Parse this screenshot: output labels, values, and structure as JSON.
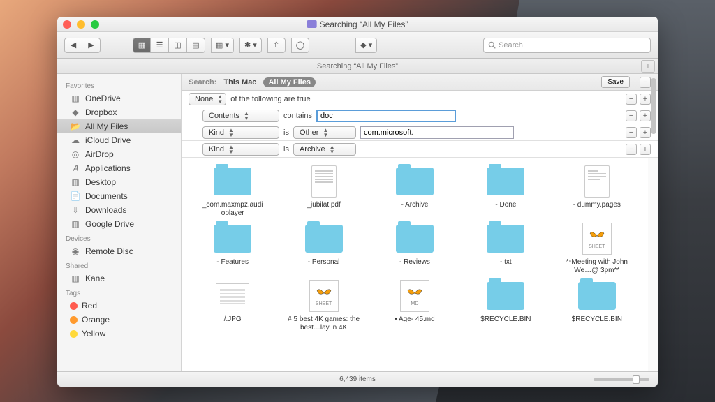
{
  "window": {
    "title": "Searching “All My Files”"
  },
  "toolbar": {
    "search_placeholder": "Search"
  },
  "pathbar": {
    "text": "Searching “All My Files”"
  },
  "sidebar": {
    "favorites": {
      "header": "Favorites",
      "items": [
        "OneDrive",
        "Dropbox",
        "All My Files",
        "iCloud Drive",
        "AirDrop",
        "Applications",
        "Desktop",
        "Documents",
        "Downloads",
        "Google Drive"
      ]
    },
    "devices": {
      "header": "Devices",
      "items": [
        "Remote Disc"
      ]
    },
    "shared": {
      "header": "Shared",
      "items": [
        "Kane"
      ]
    },
    "tags": {
      "header": "Tags",
      "items": [
        {
          "label": "Red",
          "color": "#ff5b4f"
        },
        {
          "label": "Orange",
          "color": "#ff9a2e"
        },
        {
          "label": "Yellow",
          "color": "#ffd93a"
        }
      ]
    }
  },
  "search": {
    "label": "Search:",
    "scope1": "This Mac",
    "scope2": "All My Files",
    "save": "Save",
    "rule0": {
      "match": "None",
      "suffix": "of the following are true"
    },
    "rule1": {
      "attr": "Contents",
      "op": "contains",
      "val": "doc"
    },
    "rule2": {
      "attr": "Kind",
      "op": "is",
      "val": "Other",
      "extra": "com.microsoft."
    },
    "rule3": {
      "attr": "Kind",
      "op": "is",
      "val": "Archive"
    }
  },
  "files": [
    {
      "type": "folder",
      "name": "_com.maxmpz.audi oplayer"
    },
    {
      "type": "pdf",
      "name": "_jubilat.pdf"
    },
    {
      "type": "folder",
      "name": "- Archive"
    },
    {
      "type": "folder",
      "name": "- Done"
    },
    {
      "type": "pages",
      "name": "- dummy.pages"
    },
    {
      "type": "folder",
      "name": "- Features"
    },
    {
      "type": "folder",
      "name": "- Personal"
    },
    {
      "type": "folder",
      "name": "- Reviews"
    },
    {
      "type": "folder",
      "name": "- txt"
    },
    {
      "type": "sheet",
      "name": "**Meeting with John We…@ 3pm**"
    },
    {
      "type": "jpg",
      "name": "/.JPG"
    },
    {
      "type": "sheet",
      "name": "# 5 best 4K games: the best…lay in 4K"
    },
    {
      "type": "md",
      "name": "• Age- 45.md"
    },
    {
      "type": "folder",
      "name": "$RECYCLE.BIN"
    },
    {
      "type": "folder",
      "name": "$RECYCLE.BIN"
    }
  ],
  "status": {
    "count": "6,439 items"
  },
  "labels": {
    "sheet": "SHEET",
    "md": "MD"
  }
}
